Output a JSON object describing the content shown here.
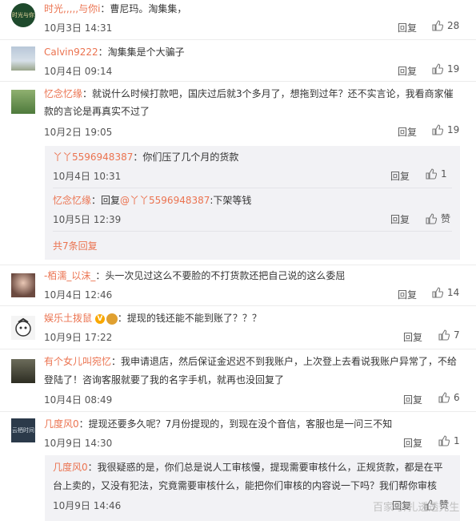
{
  "comments": [
    {
      "user": "时光,,,,,与你i",
      "text": "：曹尼玛。淘集集，",
      "date": "10月3日 14:31",
      "reply": "回复",
      "likes": "28"
    },
    {
      "user": "Calvin9222",
      "text": "：淘集集是个大骗子",
      "date": "10月4日 09:14",
      "reply": "回复",
      "likes": "19"
    },
    {
      "user": "忆念忆缘",
      "text": "：就说什么时候打款吧，国庆过后就3个多月了，想拖到过年？还不实言论，我看商家催",
      "text2": "款的言论是再真实不过了",
      "date": "10月2日 19:05",
      "reply": "回复",
      "likes": "19"
    },
    {
      "user": "-栢濡_以沫_",
      "text": "：头一次见过这么不要脸的不打货款还把自己说的这么委屈",
      "date": "10月4日 12:46",
      "reply": "回复",
      "likes": "14"
    },
    {
      "user": "娱乐土拨鼠",
      "badge": "V",
      "text": "：提现的钱还能不能到账了？？？",
      "date": "10月9日 17:22",
      "reply": "回复",
      "likes": "7"
    },
    {
      "user": "有个女儿叫宛忆",
      "text": "：我申请退店，然后保证金迟迟不到我账户，上次登上去看说我账户异常了，不给",
      "text2": "登陆了！咨询客服就要了我的名字手机，就再也没回复了",
      "date": "10月4日 08:49",
      "reply": "回复",
      "likes": "6"
    },
    {
      "user": "几度风0",
      "text": "：提现还要多久呢？7月份提现的，到现在没个音信，客服也是一问三不知",
      "date": "10月9日 14:30",
      "reply": "回复",
      "likes": "1"
    }
  ],
  "sub_replies_1": [
    {
      "user": "丫丫5596948387",
      "text": "：你们压了几个月的货款",
      "date": "10月4日 10:31",
      "reply": "回复",
      "likes": "1"
    },
    {
      "user": "忆念忆缘",
      "text": "：回复",
      "mention": "@丫丫5596948387",
      "text2": ":下架等钱",
      "date": "10月5日 12:39",
      "reply": "回复",
      "likes": "赞"
    }
  ],
  "more_link": "共7条回复",
  "sub_replies_2": [
    {
      "user": "几度风0",
      "text": "：我很疑惑的是，你们总是说人工审核慢，提现需要审核什么，正规货款，都是在平",
      "text2": "台上卖的，又没有犯法，究竟需要审核什么，能把你们审核的内容说一下吗？我们帮你审核",
      "date": "10月9日 14:46",
      "reply": "回复",
      "likes": "赞"
    }
  ],
  "avatar_texts": {
    "first": "时光与你",
    "last": "云栖时间"
  },
  "watermark": "百家号/扎透透先生"
}
